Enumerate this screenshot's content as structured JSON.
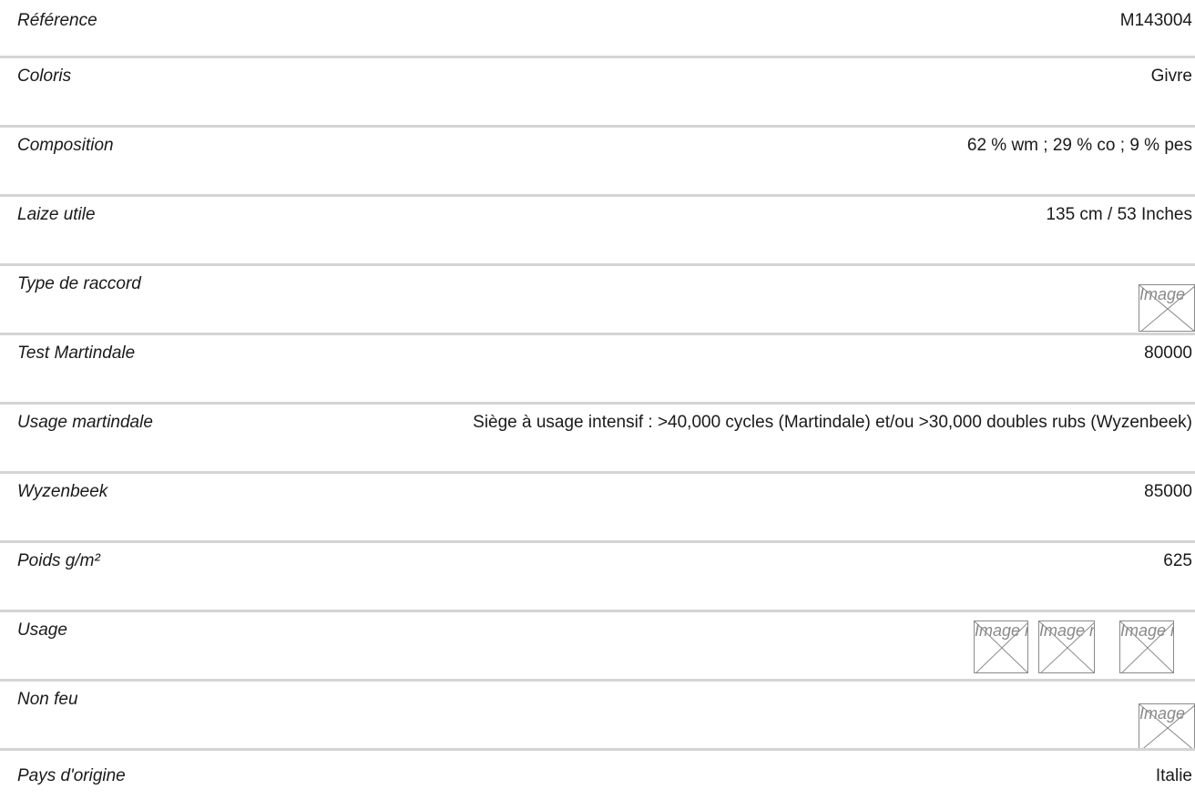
{
  "rows": [
    {
      "label": "Référence",
      "value": "M143004"
    },
    {
      "label": "Coloris",
      "value": "Givre"
    },
    {
      "label": "Composition",
      "value": "62 % wm ; 29 % co ; 9 % pes"
    },
    {
      "label": "Laize utile",
      "value": "135 cm / 53 Inches"
    },
    {
      "label": "Type de raccord",
      "image_alt": "Image"
    },
    {
      "label": "Test Martindale",
      "value": "80000"
    },
    {
      "label": "Usage martindale",
      "value": "Siège à usage intensif : >40,000 cycles (Martindale) et/ou >30,000 doubles rubs (Wyzenbeek)"
    },
    {
      "label": "Wyzenbeek",
      "value": "85000"
    },
    {
      "label": "Poids g/m²",
      "value": "625"
    },
    {
      "label": "Usage",
      "image_alts": [
        "Image non trouvée",
        "Image non trouvée",
        "Image non trouvée"
      ]
    },
    {
      "label": "Non feu",
      "image_alt": "Image"
    },
    {
      "label": "Pays d'origine",
      "value": "Italie"
    }
  ],
  "colors": {
    "text": "#1a1a1a",
    "divider": "#d4d4d4",
    "broken_image": "#8a8a8a"
  },
  "icons": {
    "broken_image": "broken-image-icon"
  }
}
